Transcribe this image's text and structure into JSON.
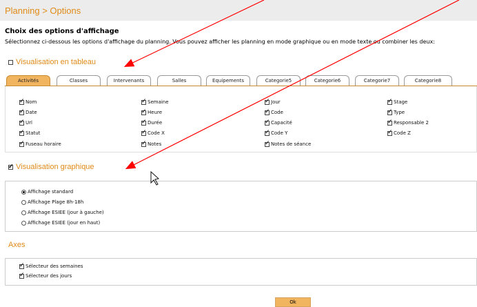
{
  "breadcrumb": "Planning > Options",
  "section_title": "Choix des options d'affichage",
  "intro": "Sélectionnez ci-dessous les options d'affichage du planning. Vous pouvez afficher les planning en mode graphique ou en mode texte ou combiner les deux:",
  "table_view": {
    "label": "Visualisation en tableau",
    "checked": false
  },
  "tabs": [
    "Activités",
    "Classes",
    "Intervenants",
    "Salles",
    "Equipements",
    "Categorie5",
    "Categorie6",
    "Categorie7",
    "Categorie8"
  ],
  "active_tab": "Activités",
  "fields": [
    [
      "Nom",
      "Date",
      "Url",
      "Statut",
      "Fuseau horaire"
    ],
    [
      "Semaine",
      "Heure",
      "Durée",
      "Code X",
      "Notes"
    ],
    [
      "Jour",
      "Code",
      "Capacité",
      "Code Y",
      "Notes de séance"
    ],
    [
      "Stage",
      "Type",
      "Responsable 2",
      "Code Z"
    ]
  ],
  "graphic_view": {
    "label": "Visualisation graphique",
    "checked": true
  },
  "display_options": [
    "Affichage standard",
    "Affichage Plage 8h-18h",
    "Affichage ESIEE (jour à gauche)",
    "Affichage ESIEE (jour en haut)"
  ],
  "selected_display": "Affichage standard",
  "axes": {
    "title": "Axes",
    "options": [
      "Sélecteur des semaines",
      "Sélecteur des jours"
    ]
  },
  "ok_label": "Ok",
  "colors": {
    "accent": "#e08a17",
    "tab_active": "#f1b45f",
    "annotation_arrow": "#ff0000"
  }
}
